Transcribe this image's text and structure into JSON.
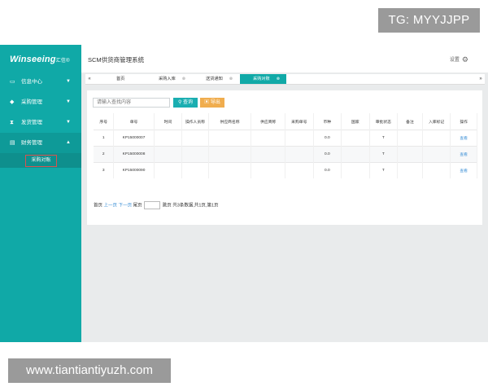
{
  "watermarks": {
    "top": "TG: MYYJJPP",
    "bottom": "www.tiantiantiyuzh.com"
  },
  "app": {
    "logo": "Winseeing",
    "logo_suffix": "汇信®",
    "title": "SCM供货商管理系统",
    "settings_label": "设置"
  },
  "sidebar": {
    "items": [
      {
        "label": "信息中心",
        "icon": "monitor-icon"
      },
      {
        "label": "采购管理",
        "icon": "car-icon"
      },
      {
        "label": "发货管理",
        "icon": "hourglass-icon"
      },
      {
        "label": "财务管理",
        "icon": "document-icon"
      }
    ],
    "sub_item": "采购对账"
  },
  "tabs": [
    {
      "label": "首页"
    },
    {
      "label": "采购入库"
    },
    {
      "label": "送货通知"
    },
    {
      "label": "采购对账"
    }
  ],
  "toolbar": {
    "search_placeholder": "请输入查找内容",
    "search_button": "查询",
    "export_button": "导出"
  },
  "table": {
    "headers": [
      "序号",
      "单号",
      "时间",
      "操作人员称",
      "供应商名称",
      "供应商称",
      "采购单号",
      "币种",
      "国家",
      "审批状态",
      "备注",
      "入库标记",
      "操作"
    ],
    "rows": [
      [
        "1",
        "KP15000007",
        "",
        "",
        "",
        "",
        "",
        "0.0",
        "",
        "T",
        "",
        "",
        "查看"
      ],
      [
        "2",
        "KP15000008",
        "",
        "",
        "",
        "",
        "",
        "0.0",
        "",
        "T",
        "",
        "",
        "查看"
      ],
      [
        "3",
        "KP15000090",
        "",
        "",
        "",
        "",
        "",
        "0.0",
        "",
        "T",
        "",
        "",
        "查看"
      ]
    ]
  },
  "pager": {
    "first": "首页",
    "prev": "上一页",
    "next": "下一页",
    "last": "尾页",
    "page_suffix": "跳页",
    "summary": "共3条数据,共1页,第1页"
  }
}
